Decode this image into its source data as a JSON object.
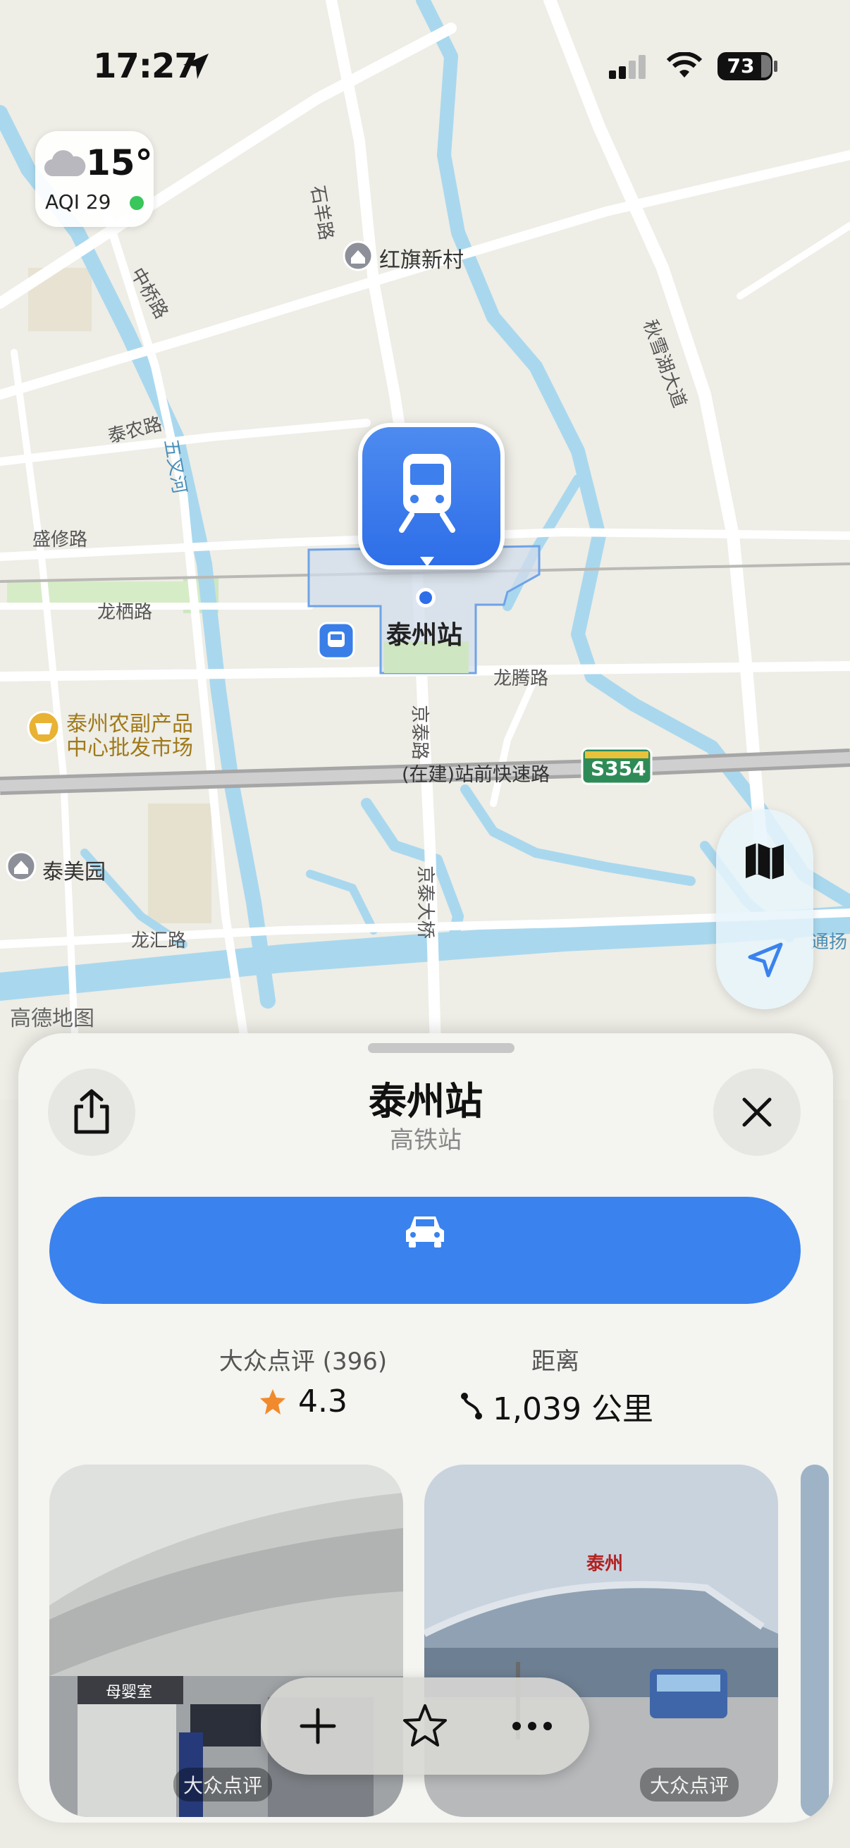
{
  "status_bar": {
    "time": "17:27",
    "battery": "73"
  },
  "weather": {
    "temperature": "15°",
    "aqi": "AQI 29"
  },
  "map": {
    "attribution": "高德地图",
    "labels": {
      "hongqi": "红旗新村",
      "shiyang": "石羊路",
      "zhongqiao": "中桥路",
      "qiuxuehu": "秋雪湖大道",
      "tainong": "泰农路",
      "wuchahe": "五叉河",
      "shengxiu": "盛修路",
      "longqi": "龙栖路",
      "station": "泰州站",
      "longteng": "龙腾路",
      "jingtai_rd": "京泰路",
      "market_line1": "泰州农副产品",
      "market_line2": "中心批发市场",
      "expressway": "(在建)站前快速路",
      "s354": "S354",
      "taimeiyuan": "泰美园",
      "jingtai_bridge": "京泰大桥",
      "longhui": "龙汇路",
      "edge": "通扬"
    }
  },
  "sheet": {
    "title": "泰州站",
    "subtitle": "高铁站",
    "stats": {
      "rating_label": "大众点评 (396)",
      "rating_value": "4.3",
      "distance_label": "距离",
      "distance_value": "1,039 公里"
    },
    "photo_source": "大众点评",
    "photo_source2": "大众点评",
    "photo_sign": "母婴室",
    "photo_sign2": "泰州"
  },
  "icons": {
    "location_arrow": "location-arrow-icon",
    "share": "share-icon",
    "close": "close-icon",
    "car": "car-icon",
    "train": "train-icon",
    "bus": "bus-icon",
    "map_mode": "map-icon",
    "locate": "locate-icon",
    "add": "plus-icon",
    "favorite": "star-icon",
    "more": "more-icon"
  },
  "colors": {
    "accent": "#3a82ee",
    "water": "#a9d8ee",
    "aqi_good": "#39c65a",
    "star": "#f08a2c"
  }
}
